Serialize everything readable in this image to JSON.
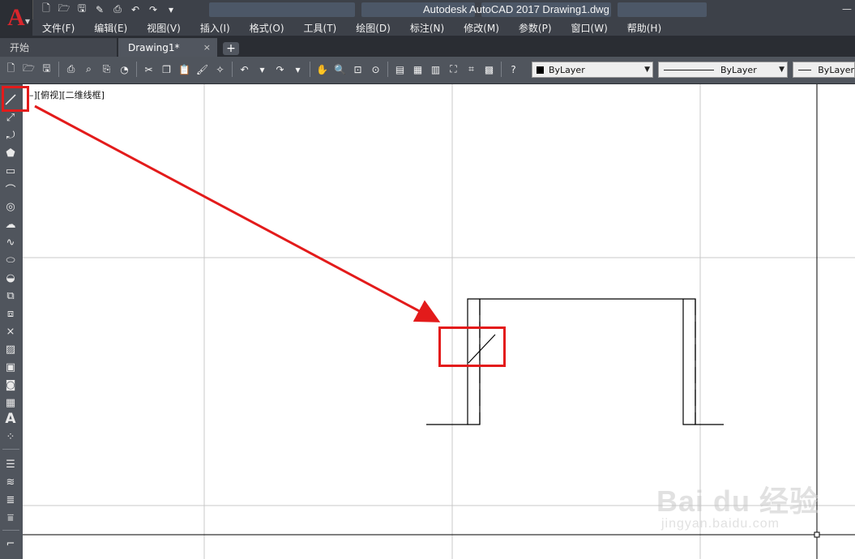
{
  "app": {
    "logo_letter": "A",
    "window_title": "Autodesk AutoCAD 2017    Drawing1.dwg"
  },
  "quick_access": [
    "new-icon",
    "open-icon",
    "save-icon",
    "saveas-icon",
    "plot-icon",
    "undo-icon",
    "redo-icon",
    "more-icon"
  ],
  "menu": [
    "文件(F)",
    "编辑(E)",
    "视图(V)",
    "插入(I)",
    "格式(O)",
    "工具(T)",
    "绘图(D)",
    "标注(N)",
    "修改(M)",
    "参数(P)",
    "窗口(W)",
    "帮助(H)"
  ],
  "tabs": {
    "start": "开始",
    "drawing": "Drawing1*",
    "close": "×",
    "add": "+"
  },
  "properties": {
    "color": "ByLayer",
    "linetype": "ByLayer",
    "lineweight": "ByLayer"
  },
  "viewport_label": "–][俯视][二维线框]",
  "watermark": {
    "brand": "Bai du 经验",
    "url": "jingyan.baidu.com"
  },
  "colors": {
    "highlight": "#e31b1b",
    "ui_dark": "#3d4149",
    "canvas": "#ffffff"
  }
}
